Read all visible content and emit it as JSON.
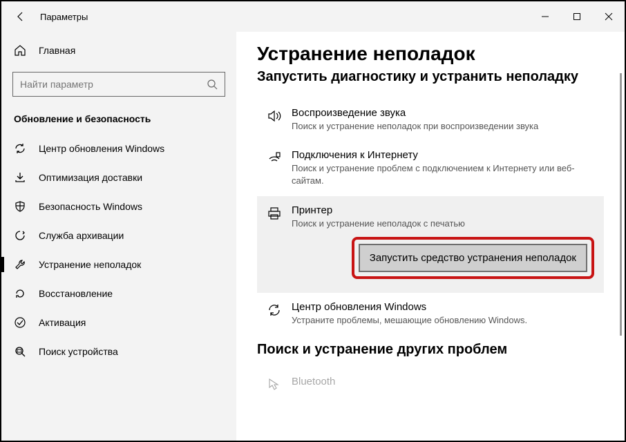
{
  "window": {
    "title": "Параметры"
  },
  "sidebar": {
    "home": "Главная",
    "search_placeholder": "Найти параметр",
    "category": "Обновление и безопасность",
    "items": [
      {
        "label": "Центр обновления Windows"
      },
      {
        "label": "Оптимизация доставки"
      },
      {
        "label": "Безопасность Windows"
      },
      {
        "label": "Служба архивации"
      },
      {
        "label": "Устранение неполадок"
      },
      {
        "label": "Восстановление"
      },
      {
        "label": "Активация"
      },
      {
        "label": "Поиск устройства"
      }
    ]
  },
  "main": {
    "title": "Устранение неполадок",
    "subtitle": "Запустить диагностику и устранить неполадку",
    "items": [
      {
        "title": "Воспроизведение звука",
        "desc": "Поиск и устранение неполадок при воспроизведении звука"
      },
      {
        "title": "Подключения к Интернету",
        "desc": "Поиск и устранение проблем с подключением к Интернету или веб-сайтам."
      },
      {
        "title": "Принтер",
        "desc": "Поиск и устранение неполадок с печатью"
      },
      {
        "title": "Центр обновления Windows",
        "desc": "Устраните проблемы, мешающие обновлению Windows."
      }
    ],
    "run_button": "Запустить средство устранения неполадок",
    "section2": "Поиск и устранение других проблем",
    "bt": "Bluetooth"
  }
}
